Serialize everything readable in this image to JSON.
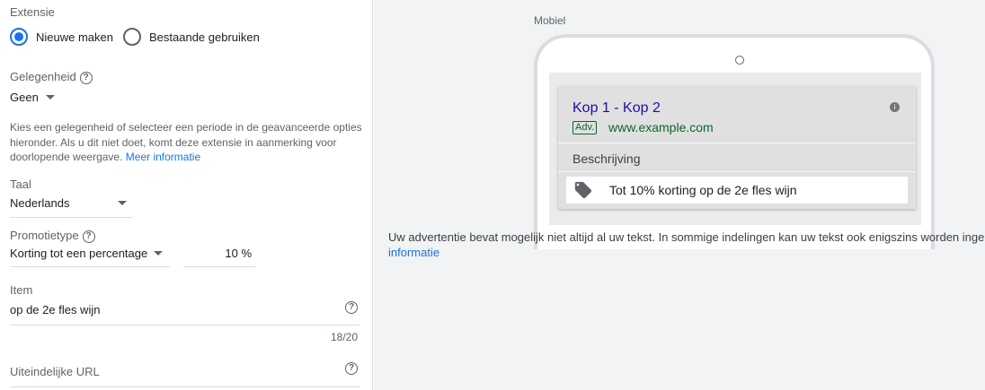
{
  "extension": {
    "label": "Extensie",
    "options": [
      {
        "label": "Nieuwe maken",
        "selected": true
      },
      {
        "label": "Bestaande gebruiken",
        "selected": false
      }
    ]
  },
  "occasion": {
    "label": "Gelegenheid",
    "value": "Geen",
    "description": "Kies een gelegenheid of selecteer een periode in de geavanceerde opties hieronder. Als u dit niet doet, komt deze extensie in aanmerking voor doorlopende weergave.",
    "link": "Meer informatie"
  },
  "language": {
    "label": "Taal",
    "value": "Nederlands"
  },
  "promotion_type": {
    "label": "Promotietype",
    "value": "Korting tot een percentage",
    "amount": "10",
    "unit": "%"
  },
  "item": {
    "label": "Item",
    "value": "op de 2e fles wijn",
    "counter": "18/20"
  },
  "final_url": {
    "label": "Uiteindelijke URL"
  },
  "preview": {
    "device_label": "Mobiel",
    "ad_title": "Kop 1 - Kop 2",
    "ad_badge": "Adv.",
    "ad_url": "www.example.com",
    "ad_description": "Beschrijving",
    "promo_text": "Tot 10% korting op de 2e fles wijn",
    "notice_line1": "Uw advertentie bevat mogelijk niet altijd al uw tekst. In sommige indelingen kan uw tekst ook enigszins worden inge",
    "notice_link": "informatie"
  },
  "colors": {
    "accent": "#1a73e8",
    "ad_title": "#1a0dab",
    "ad_url": "#0d652d"
  }
}
